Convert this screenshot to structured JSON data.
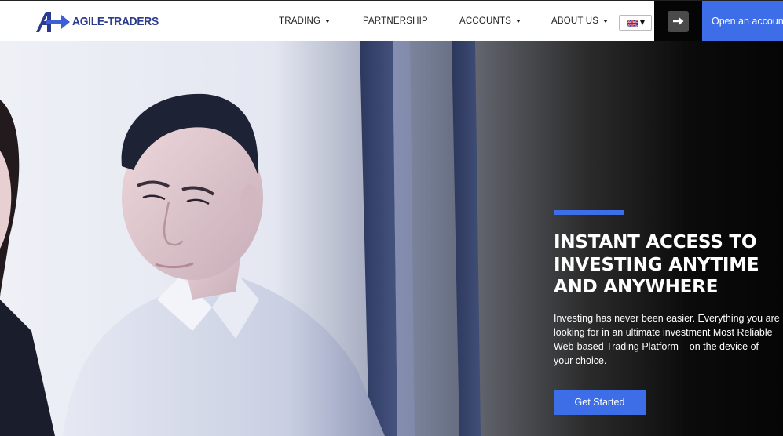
{
  "brand": {
    "name": "AGILE-TRADERS",
    "logo_icon": "agile-traders-logo-icon",
    "color": "#2b3a8c"
  },
  "nav": {
    "items": [
      {
        "label": "TRADING",
        "has_dropdown": true
      },
      {
        "label": "PARTNERSHIP",
        "has_dropdown": false
      },
      {
        "label": "ACCOUNTS",
        "has_dropdown": true
      },
      {
        "label": "ABOUT US",
        "has_dropdown": true
      }
    ],
    "language_icon": "uk-flag-icon",
    "login_icon": "arrow-right-icon",
    "open_account_label": "Open an account"
  },
  "hero": {
    "title": "INSTANT ACCESS TO\nINVESTING ANYTIME\nAND ANYWHERE",
    "text": "Investing has never been easier. Everything you are\nlooking for in an ultimate investment Most Reliable\nWeb-based Trading Platform – on the device of\nyour choice.",
    "cta_label": "Get Started"
  },
  "colors": {
    "accent": "#3d6ee8",
    "dark": "#050505",
    "text_on_dark": "#ffffff"
  }
}
